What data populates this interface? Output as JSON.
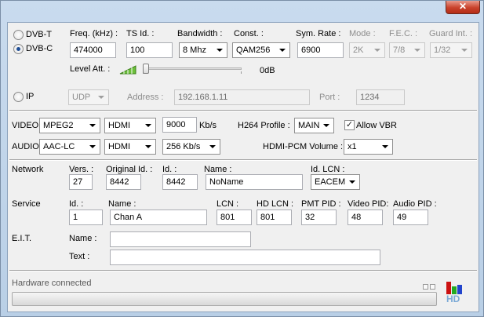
{
  "window": {
    "close_glyph": "✕"
  },
  "tuner": {
    "dvbt_label": "DVB-T",
    "dvbc_label": "DVB-C",
    "selected_mode": "DVB-C",
    "headers": {
      "freq": "Freq. (kHz) :",
      "ts_id": "TS Id. :",
      "bandwidth": "Bandwidth :",
      "const": "Const. :",
      "sym_rate": "Sym. Rate :",
      "mode": "Mode :",
      "fec": "F.E.C. :",
      "guard": "Guard Int. :"
    },
    "freq_value": "474000",
    "ts_id_value": "100",
    "bandwidth_value": "8 Mhz",
    "const_value": "QAM256",
    "sym_rate_value": "6900",
    "mode_value": "2K",
    "fec_value": "7/8",
    "guard_value": "1/32",
    "level_att_label": "Level Att. :",
    "level_att_value": "0dB",
    "level_att_fraction": 0.0
  },
  "ip": {
    "label": "IP",
    "protocol_value": "UDP",
    "address_label": "Address :",
    "address_value": "192.168.1.11",
    "port_label": "Port :",
    "port_value": "1234"
  },
  "av": {
    "video_label": "VIDEO",
    "video_codec": "MPEG2",
    "video_input": "HDMI",
    "video_bitrate": "9000",
    "video_bitrate_unit": "Kb/s",
    "h264_profile_label": "H264 Profile :",
    "h264_profile_value": "MAIN",
    "allow_vbr_label": "Allow VBR",
    "allow_vbr_checked": true,
    "audio_label": "AUDIO",
    "audio_codec": "AAC-LC",
    "audio_input": "HDMI",
    "audio_bitrate": "256 Kb/s",
    "hdmi_pcm_label": "HDMI-PCM Volume :",
    "hdmi_pcm_value": "x1"
  },
  "network": {
    "label": "Network",
    "vers_label": "Vers. :",
    "vers_value": "27",
    "orig_id_label": "Original Id. :",
    "orig_id_value": "8442",
    "id_label": "Id. :",
    "id_value": "8442",
    "name_label": "Name :",
    "name_value": "NoName",
    "id_lcn_label": "Id. LCN :",
    "id_lcn_value": "EACEM"
  },
  "service": {
    "label": "Service",
    "id_label": "Id. :",
    "id_value": "1",
    "name_label": "Name :",
    "name_value": "Chan A",
    "lcn_label": "LCN :",
    "lcn_value": "801",
    "hd_lcn_label": "HD LCN :",
    "hd_lcn_value": "801",
    "pmt_pid_label": "PMT PID :",
    "pmt_pid_value": "32",
    "video_pid_label": "Video PID:",
    "video_pid_value": "48",
    "audio_pid_label": "Audio PID :",
    "audio_pid_value": "49"
  },
  "eit": {
    "label": "E.I.T.",
    "name_label": "Name :",
    "name_value": "",
    "text_label": "Text :",
    "text_value": ""
  },
  "status": {
    "text": "Hardware connected",
    "progress_fraction": 0.0,
    "hd_logo_text": "HD"
  },
  "colors": {
    "logo_red": "#cc1111",
    "logo_green": "#22aa22",
    "logo_blue": "#2244cc",
    "hd_text": "#7aa9d6"
  }
}
